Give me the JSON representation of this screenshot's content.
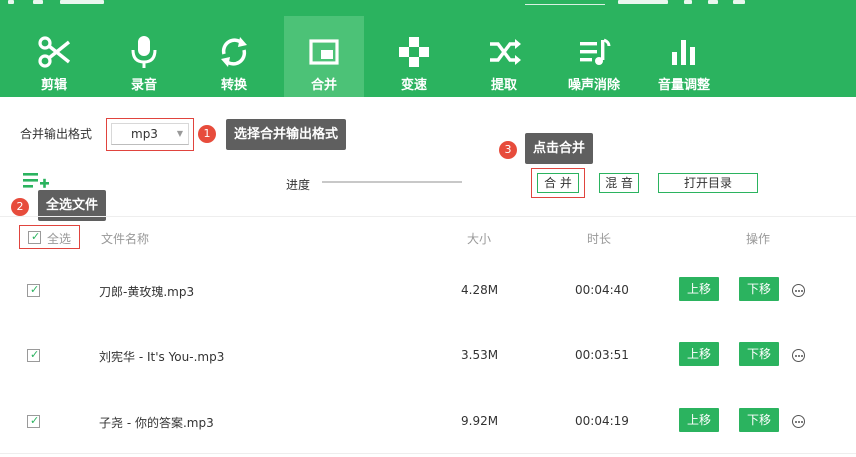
{
  "toolbar": {
    "items": [
      {
        "label": "剪辑",
        "icon": "scissors-icon"
      },
      {
        "label": "录音",
        "icon": "microphone-icon"
      },
      {
        "label": "转换",
        "icon": "convert-icon"
      },
      {
        "label": "合并",
        "icon": "merge-icon"
      },
      {
        "label": "变速",
        "icon": "speed-icon"
      },
      {
        "label": "提取",
        "icon": "extract-icon"
      },
      {
        "label": "噪声消除",
        "icon": "noise-removal-icon"
      },
      {
        "label": "音量调整",
        "icon": "volume-adjust-icon"
      }
    ],
    "active": "合并"
  },
  "settings": {
    "format_label": "合并输出格式",
    "format_value": "mp3",
    "progress_label": "进度",
    "progress": 0
  },
  "buttons": {
    "merge": "合 并",
    "mix": "混 音",
    "open_dir": "打开目录"
  },
  "tips": {
    "t1": {
      "badge": "1",
      "text": "选择合并输出格式"
    },
    "t2": {
      "badge": "2",
      "text": "全选文件"
    },
    "t3": {
      "badge": "3",
      "text": "点击合并"
    }
  },
  "table": {
    "select_all": "全选",
    "headers": {
      "name": "文件名称",
      "size": "大小",
      "duration": "时长",
      "action": "操作"
    },
    "rows": [
      {
        "name": "刀郎-黄玫瑰.mp3",
        "size": "4.28M",
        "duration": "00:04:40",
        "up": "上移",
        "down": "下移",
        "checked": true
      },
      {
        "name": "刘宪华 - It's You-.mp3",
        "size": "3.53M",
        "duration": "00:03:51",
        "up": "上移",
        "down": "下移",
        "checked": true
      },
      {
        "name": "子尧 - 你的答案.mp3",
        "size": "9.92M",
        "duration": "00:04:19",
        "up": "上移",
        "down": "下移",
        "checked": true
      }
    ]
  },
  "colors": {
    "brand": "#2bb35f",
    "highlight": "#e0443e",
    "tooltip": "#5f5f5f"
  }
}
